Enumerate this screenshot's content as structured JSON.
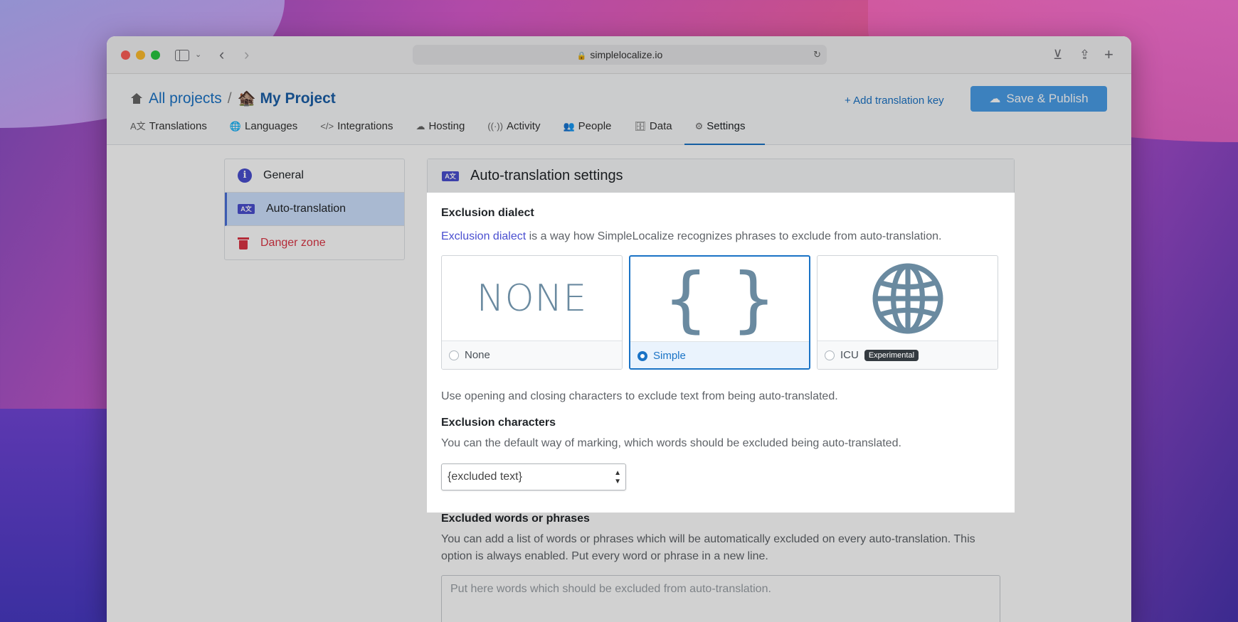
{
  "browser": {
    "url": "simplelocalize.io"
  },
  "header": {
    "crumb_all": "All projects",
    "crumb_sep": "/",
    "project_emoji": "🏚️",
    "project_name": "My Project",
    "add_key": "+ Add translation key",
    "save_publish": "Save & Publish"
  },
  "tabs": [
    {
      "label": "Translations",
      "icon": "A文"
    },
    {
      "label": "Languages",
      "icon": "🌐"
    },
    {
      "label": "Integrations",
      "icon": "</>"
    },
    {
      "label": "Hosting",
      "icon": "☁"
    },
    {
      "label": "Activity",
      "icon": "((·))"
    },
    {
      "label": "People",
      "icon": "👥"
    },
    {
      "label": "Data",
      "icon": "🗄"
    },
    {
      "label": "Settings",
      "icon": "⚙"
    }
  ],
  "sidebar": {
    "items": [
      {
        "label": "General"
      },
      {
        "label": "Auto-translation"
      },
      {
        "label": "Danger zone"
      }
    ]
  },
  "panel": {
    "title": "Auto-translation settings",
    "exclusion_dialect": {
      "heading": "Exclusion dialect",
      "link": "Exclusion dialect",
      "desc": " is a way how SimpleLocalize recognizes phrases to exclude from auto-translation.",
      "options": [
        {
          "label": "None",
          "art": "NONE",
          "selected": false
        },
        {
          "label": "Simple",
          "art": "{ }",
          "selected": true
        },
        {
          "label": "ICU",
          "badge": "Experimental",
          "selected": false
        }
      ],
      "hint": "Use opening and closing characters to exclude text from being auto-translated."
    },
    "exclusion_chars": {
      "heading": "Exclusion characters",
      "desc": "You can the default way of marking, which words should be excluded being auto-translated.",
      "selected": "{excluded text}"
    },
    "excluded_words": {
      "heading": "Excluded words or phrases",
      "desc": "You can add a list of words or phrases which will be automatically excluded on every auto-translation. This option is always enabled. Put every word or phrase in a new line.",
      "placeholder": "Put here words which should be excluded from auto-translation."
    }
  },
  "colors": {
    "accent": "#1a73c6",
    "save_button": "#4a9ee8",
    "danger": "#dc3545",
    "icon_blue": "#4a4fd0"
  }
}
